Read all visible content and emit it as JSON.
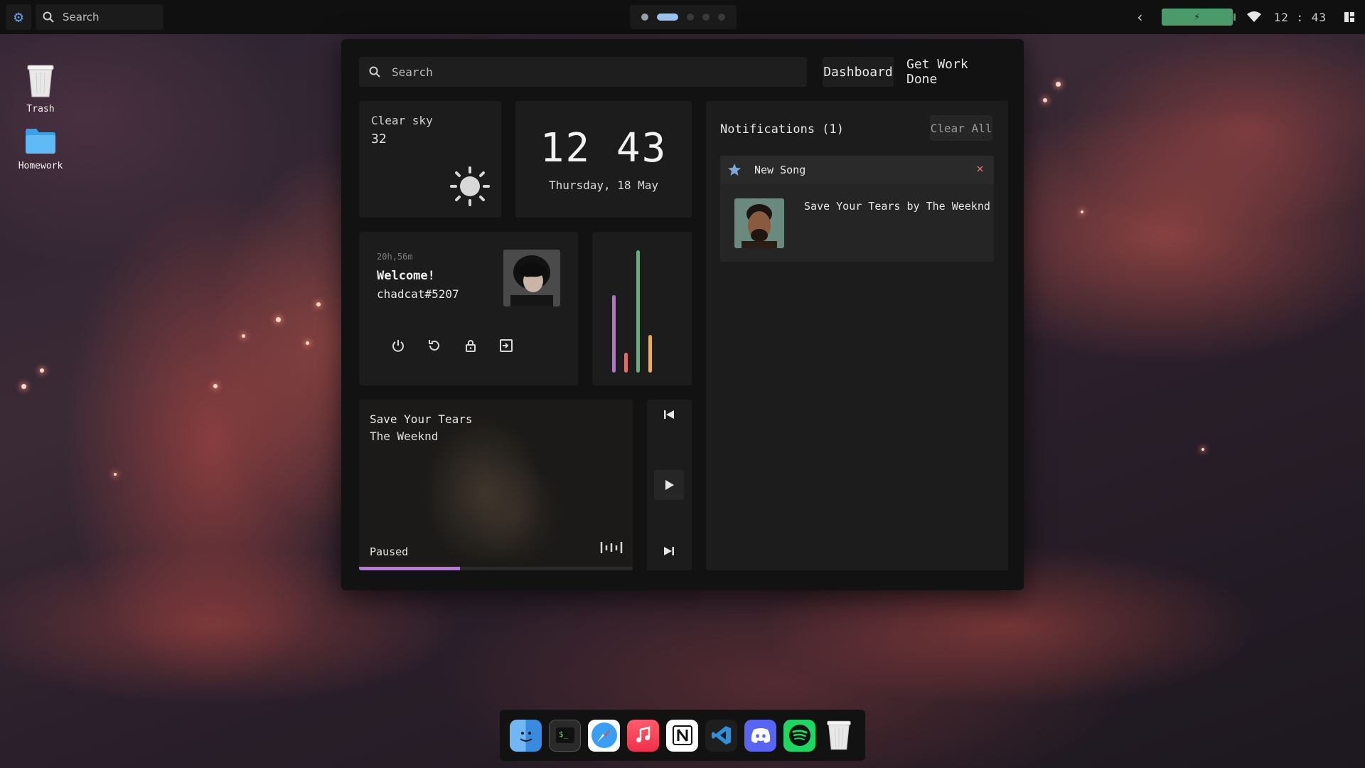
{
  "topbar": {
    "search_label": "Search",
    "clock": "12 : 43"
  },
  "desktop": {
    "icons": [
      {
        "label": "Trash"
      },
      {
        "label": "Homework"
      }
    ]
  },
  "dashboard": {
    "search_placeholder": "Search",
    "tabs": [
      "Dashboard",
      "Get Work Done"
    ],
    "weather": {
      "condition": "Clear sky",
      "temperature": "32",
      "icon": "sun-icon"
    },
    "clock": {
      "time": "12 43",
      "date": "Thursday, 18 May"
    },
    "profile": {
      "uptime": "20h,56m",
      "greeting": "Welcome!",
      "username": "chadcat#5207"
    },
    "system_bars": [
      {
        "level": 0.62,
        "color": "#b86fd0"
      },
      {
        "level": 0.16,
        "color": "#e06c6c"
      },
      {
        "level": 0.98,
        "color": "#5fb07a"
      },
      {
        "level": 0.3,
        "color": "#e0b060"
      }
    ],
    "player": {
      "song": "Save Your Tears",
      "artist": "The Weeknd",
      "status": "Paused",
      "progress": 0.37
    },
    "notifications": {
      "title": "Notifications (1)",
      "clear_label": "Clear All",
      "items": [
        {
          "app": "New Song",
          "message": "Save Your Tears by The Weeknd"
        }
      ]
    }
  },
  "dock": {
    "apps": [
      "finder-icon",
      "terminal-icon",
      "safari-icon",
      "music-icon",
      "notion-icon",
      "vscode-icon",
      "discord-icon",
      "spotify-icon",
      "trash-icon"
    ]
  },
  "colors": {
    "accent": "#b37bd6",
    "battery": "#4a9a6a",
    "close": "#e06c6c"
  }
}
